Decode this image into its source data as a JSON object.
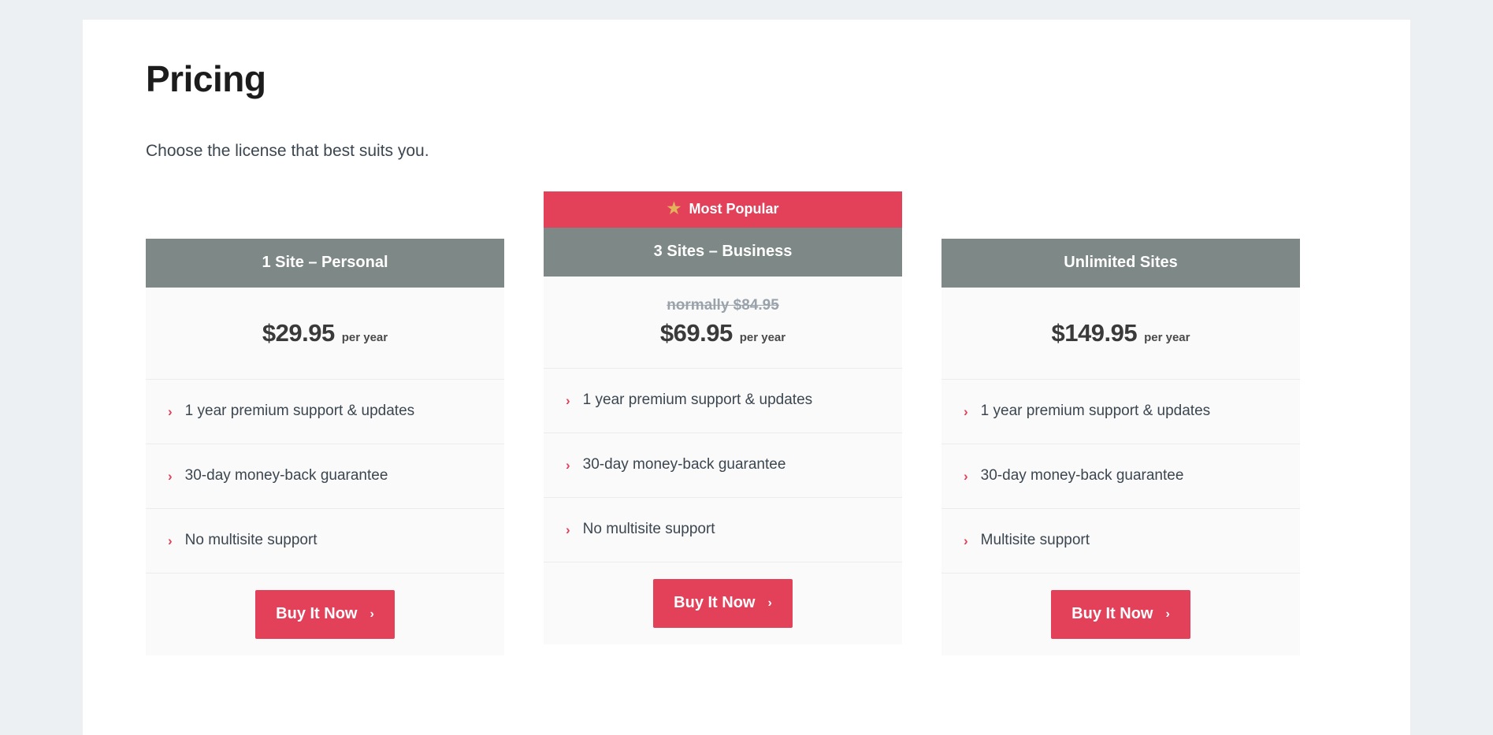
{
  "page": {
    "title": "Pricing",
    "subtitle": "Choose the license that best suits you."
  },
  "colors": {
    "accent": "#e3405a",
    "header_gray": "#7e8886",
    "star_gold": "#e3b35c",
    "page_background": "#edf0f2",
    "card_background": "#fafafa"
  },
  "icons": {
    "star": "★",
    "chevron": "›",
    "arrow": "›"
  },
  "plans": [
    {
      "name": "1 Site – Personal",
      "badge": null,
      "old_price": null,
      "price": "$29.95",
      "period": "per year",
      "features": [
        "1 year premium support & updates",
        "30-day money-back guarantee",
        "No multisite support"
      ],
      "cta": "Buy It Now"
    },
    {
      "name": "3 Sites – Business",
      "badge": "Most Popular",
      "old_price": "normally $84.95",
      "price": "$69.95",
      "period": "per year",
      "features": [
        "1 year premium support & updates",
        "30-day money-back guarantee",
        "No multisite support"
      ],
      "cta": "Buy It Now"
    },
    {
      "name": "Unlimited Sites",
      "badge": null,
      "old_price": null,
      "price": "$149.95",
      "period": "per year",
      "features": [
        "1 year premium support & updates",
        "30-day money-back guarantee",
        "Multisite support"
      ],
      "cta": "Buy It Now"
    }
  ]
}
